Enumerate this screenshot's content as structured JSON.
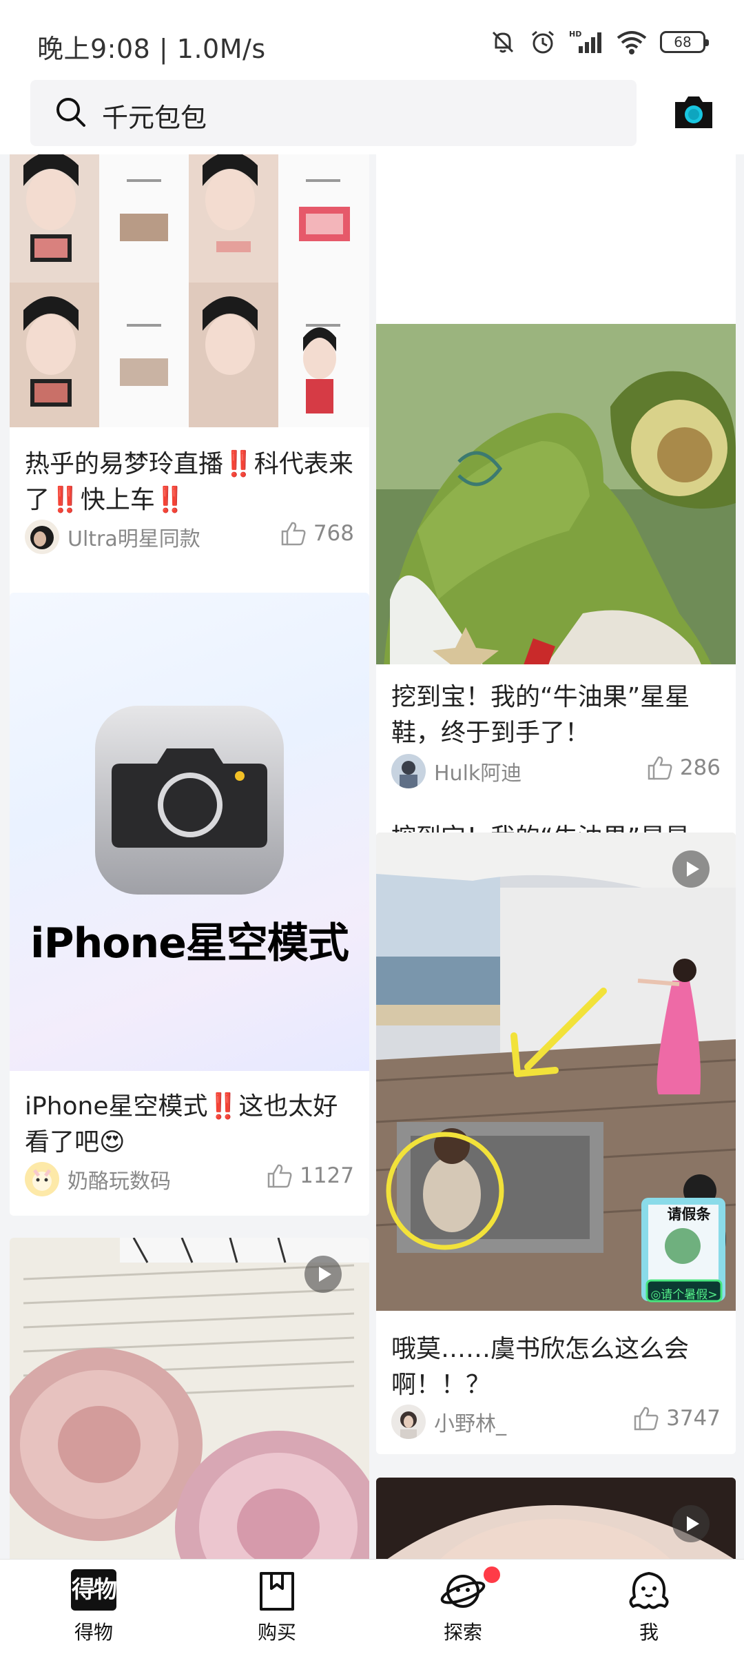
{
  "status_bar": {
    "time": "晚上9:08 | 1.0M/s",
    "battery": "68",
    "icons": [
      "mute-icon",
      "alarm-icon",
      "signal-icon",
      "wifi-icon",
      "battery-icon"
    ]
  },
  "search": {
    "query": "千元包包",
    "icon": "search-icon",
    "camera_icon": "camera-icon"
  },
  "feed": {
    "cards": [
      {
        "title": "热乎的易梦玲直播‼️科代表来了‼️快上车‼️",
        "author": "Ultra明星同款",
        "likes": "768"
      },
      {
        "title": "挖到宝！我的“牛油果”星星鞋，终于到手了！",
        "author": "Hulk阿迪",
        "likes": "286"
      },
      {
        "title": "iPhone星空模式‼️这也太好看了吧😍",
        "author": "奶酪玩数码",
        "likes": "1127",
        "image_text": "iPhone星空模式"
      },
      {
        "title": "哦莫……虞书欣怎么这么会啊！！？",
        "author": "小野林_",
        "likes": "3747",
        "badge_top": "请假条",
        "badge_bottom": "◎请个暑假>"
      }
    ]
  },
  "bottom_nav": {
    "items": [
      {
        "label": "得物",
        "icon": "dewu-logo-icon"
      },
      {
        "label": "购买",
        "icon": "shopping-bag-icon"
      },
      {
        "label": "探索",
        "icon": "planet-icon"
      },
      {
        "label": "我",
        "icon": "ghost-profile-icon"
      }
    ],
    "logo_text": "得物"
  },
  "colors": {
    "accent": "#ff3b47",
    "camera_lens": "#19c6e0",
    "text_secondary": "#888888"
  }
}
